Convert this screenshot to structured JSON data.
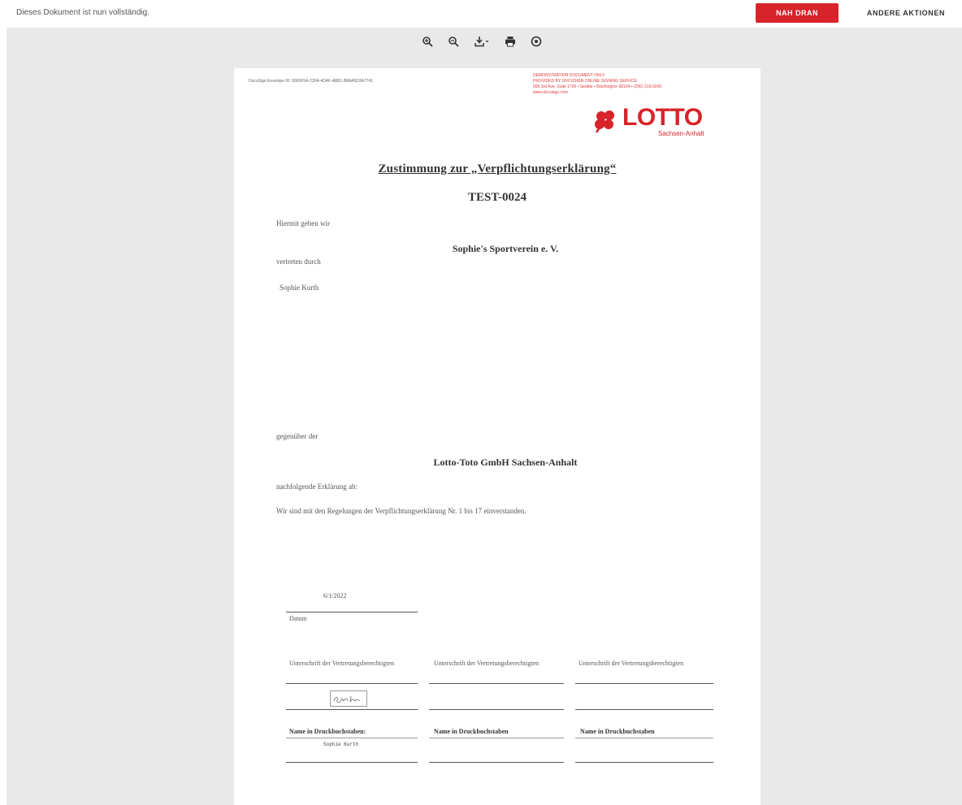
{
  "topbar": {
    "status_text": "Dieses Dokument ist nun vollständig.",
    "primary_button": "NAH DRAN",
    "more_actions": "ANDERE AKTIONEN"
  },
  "toolbar": {
    "icons": [
      "zoom-in-icon",
      "zoom-out-icon",
      "download-icon",
      "print-icon",
      "help-icon"
    ]
  },
  "page": {
    "envelope_id": "DocuSign Envelope ID: 9365F5A-22FA-4DAF-A8B1-B8AA5D3A7741",
    "demo_notice": [
      "DEMONSTRATION DOCUMENT ONLY",
      "PROVIDED BY DOCUSIGN ONLINE SIGNING SERVICE",
      "999 3rd Ave, Suite 1700 • Seattle • Washington 98104 • (206) 219-0200",
      "www.docusign.com"
    ],
    "logo": {
      "word": "LOTTO",
      "sub": "Sachsen-Anhalt"
    },
    "title": "Zustimmung zur „Verpflichtungserklärung“",
    "subtitle": "TEST-0024",
    "line_hiermit": "Hiermit geben wir",
    "organization": "Sophie's Sportverein e. V.",
    "line_vertreten": "vertreten durch",
    "representative": "Sophie Kurth",
    "line_gegenueber": "gegenüber der",
    "counterparty": "Lotto-Toto GmbH Sachsen-Anhalt",
    "line_nachfolgende": "nachfolgende Erklärung ab:",
    "statement": "Wir sind mit den Regelungen der Verpflichtungserklärung Nr. 1 bis 17 einverstanden.",
    "date_value": "6/1/2022",
    "date_label": "Datum",
    "signature_label": "Unterschrift der Vertretungsberechtigten",
    "signature_handwritten": "Sophie Kurth",
    "print_label": "Name in Druckbuchstaben:",
    "print_label_plain": "Name in Druckbuchstaben",
    "printed_name": "Sophie Kurth"
  },
  "colors": {
    "accent": "#d8232a",
    "viewer_bg": "#e9e9e9",
    "demo_red": "#e23d3d"
  }
}
